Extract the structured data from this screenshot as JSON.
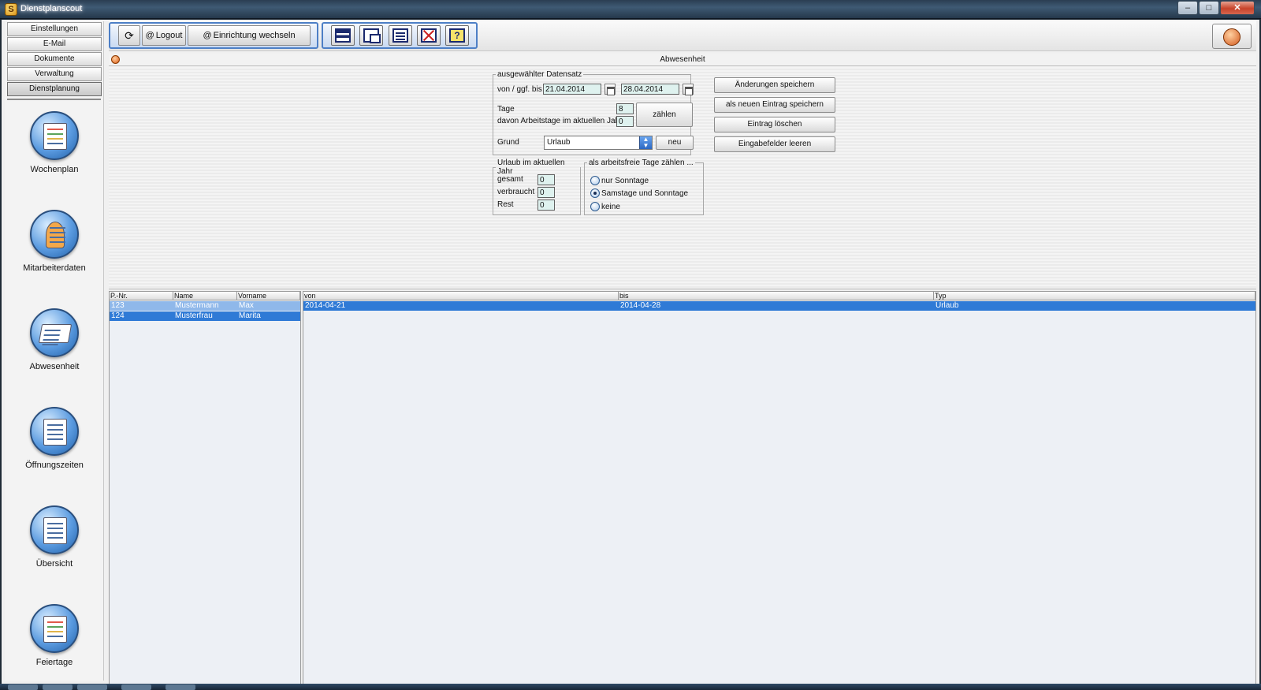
{
  "window": {
    "title": "Dienstplanscout",
    "app_icon_letter": "S",
    "controls": {
      "minimize": "–",
      "maximize": "□",
      "close": "✕"
    }
  },
  "sidebar": {
    "nav_buttons": [
      "Einstellungen",
      "E-Mail",
      "Dokumente",
      "Verwaltung",
      "Dienstplanung"
    ],
    "modules": [
      {
        "label": "Wochenplan",
        "icon": "calendar-icon"
      },
      {
        "label": "Mitarbeiterdaten",
        "icon": "people-icon"
      },
      {
        "label": "Abwesenheit",
        "icon": "book-icon"
      },
      {
        "label": "Öffnungszeiten",
        "icon": "clipboard-icon"
      },
      {
        "label": "Übersicht",
        "icon": "clipboard-icon"
      },
      {
        "label": "Feiertage",
        "icon": "calendar-pen-icon"
      }
    ]
  },
  "toolbar": {
    "refresh_icon": "⟳",
    "logout_label": "Logout",
    "switch_label": "Einrichtung wechseln",
    "link_icon": "@",
    "help_glyph": "?",
    "icon_buttons": [
      "list-view-icon",
      "windows-icon",
      "document-icon",
      "delete-icon",
      "help-icon"
    ],
    "power_icon": "power-icon"
  },
  "section": {
    "title": "Abwesenheit"
  },
  "record": {
    "legend": "ausgewählter Datensatz",
    "von_bis_label": "von / ggf. bis",
    "von": "21.04.2014",
    "bis": "28.04.2014",
    "tage_label": "Tage",
    "tage": "8",
    "arbeitstage_label": "davon Arbeitstage im aktuellen Jahr",
    "arbeitstage": "0",
    "zaehlen_label": "zählen",
    "grund_label": "Grund",
    "grund": "Urlaub",
    "neu_label": "neu"
  },
  "urlaub": {
    "legend": "Urlaub im aktuellen Jahr",
    "gesamt_label": "gesamt",
    "gesamt": "0",
    "verbraucht_label": "verbraucht",
    "verbraucht": "0",
    "rest_label": "Rest",
    "rest": "0"
  },
  "freetage": {
    "legend": "als arbeitsfreie Tage zählen ...",
    "options": [
      "nur Sonntage",
      "Samstage und Sonntage",
      "keine"
    ],
    "selected": "Samstage und Sonntage"
  },
  "actions": {
    "save_changes": "Änderungen speichern",
    "save_new": "als neuen Eintrag speichern",
    "delete": "Eintrag löschen",
    "clear": "Eingabefelder leeren"
  },
  "employees": {
    "columns": [
      "P.-Nr.",
      "Name",
      "Vorname"
    ],
    "rows": [
      [
        "123",
        "Mustermann",
        "Max"
      ],
      [
        "124",
        "Musterfrau",
        "Marita"
      ]
    ],
    "selected_index": 1,
    "colors": {
      "row": "#8fb8ea",
      "selected": "#2f7ad6"
    }
  },
  "absences": {
    "columns": [
      "von",
      "bis",
      "Typ"
    ],
    "rows": [
      [
        "2014-04-21",
        "2014-04-28",
        "Urlaub"
      ]
    ],
    "colors": {
      "selected": "#2f7ad6"
    }
  }
}
